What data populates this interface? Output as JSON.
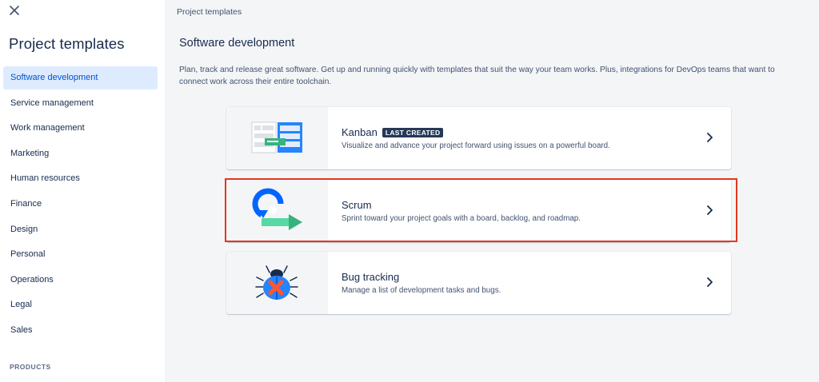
{
  "sidebar": {
    "title": "Project templates",
    "items": [
      {
        "label": "Software development",
        "active": true
      },
      {
        "label": "Service management"
      },
      {
        "label": "Work management"
      },
      {
        "label": "Marketing"
      },
      {
        "label": "Human resources"
      },
      {
        "label": "Finance"
      },
      {
        "label": "Design"
      },
      {
        "label": "Personal"
      },
      {
        "label": "Operations"
      },
      {
        "label": "Legal"
      },
      {
        "label": "Sales"
      }
    ],
    "products_label": "PRODUCTS"
  },
  "main": {
    "breadcrumb": "Project templates",
    "title": "Software development",
    "description": "Plan, track and release great software. Get up and running quickly with templates that suit the way your team works. Plus, integrations for DevOps teams that want to connect work across their entire toolchain.",
    "templates": [
      {
        "title": "Kanban",
        "badge": "LAST CREATED",
        "description": "Visualize and advance your project forward using issues on a powerful board.",
        "icon": "kanban-board-illustration"
      },
      {
        "title": "Scrum",
        "description": "Sprint toward your project goals with a board, backlog, and roadmap.",
        "icon": "scrum-cycle-illustration",
        "highlighted": true
      },
      {
        "title": "Bug tracking",
        "description": "Manage a list of development tasks and bugs.",
        "icon": "bug-illustration"
      }
    ]
  },
  "colors": {
    "accent": "#0052cc",
    "active_bg": "#deebff",
    "highlight_border": "#e4371f",
    "lozenge_bg": "#253858"
  }
}
